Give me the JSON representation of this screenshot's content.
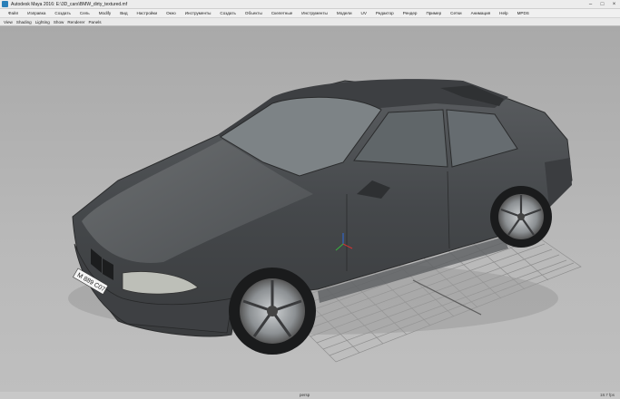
{
  "window": {
    "title": "Autodesk Maya 2016: E:\\3D_cars\\BMW_dirty_textured.mf"
  },
  "menubar": {
    "items": [
      "Файл",
      "Изправка",
      "Создать",
      "Сель",
      "Modify",
      "Вид",
      "Настройки",
      "Окно",
      "Инструменты",
      "Создать",
      "Объекты",
      "Скелетные",
      "Инструменты",
      "Модели",
      "UV",
      "Редактор",
      "Рендер",
      "Пример",
      "Сетки",
      "Анимация",
      "Help",
      "MPDS"
    ]
  },
  "viewport_menu": {
    "items": [
      "View",
      "Shading",
      "Lighting",
      "Show",
      "Renderer",
      "Panels"
    ]
  },
  "viewport": {
    "camera_label": "persp",
    "fps_label": "18.7 fps",
    "license_plate": "M 889 C07"
  },
  "colors": {
    "viewport_bg": "#b4b4b4",
    "grid_line": "#8c8c8c",
    "car_body": "#4a4c4e"
  }
}
